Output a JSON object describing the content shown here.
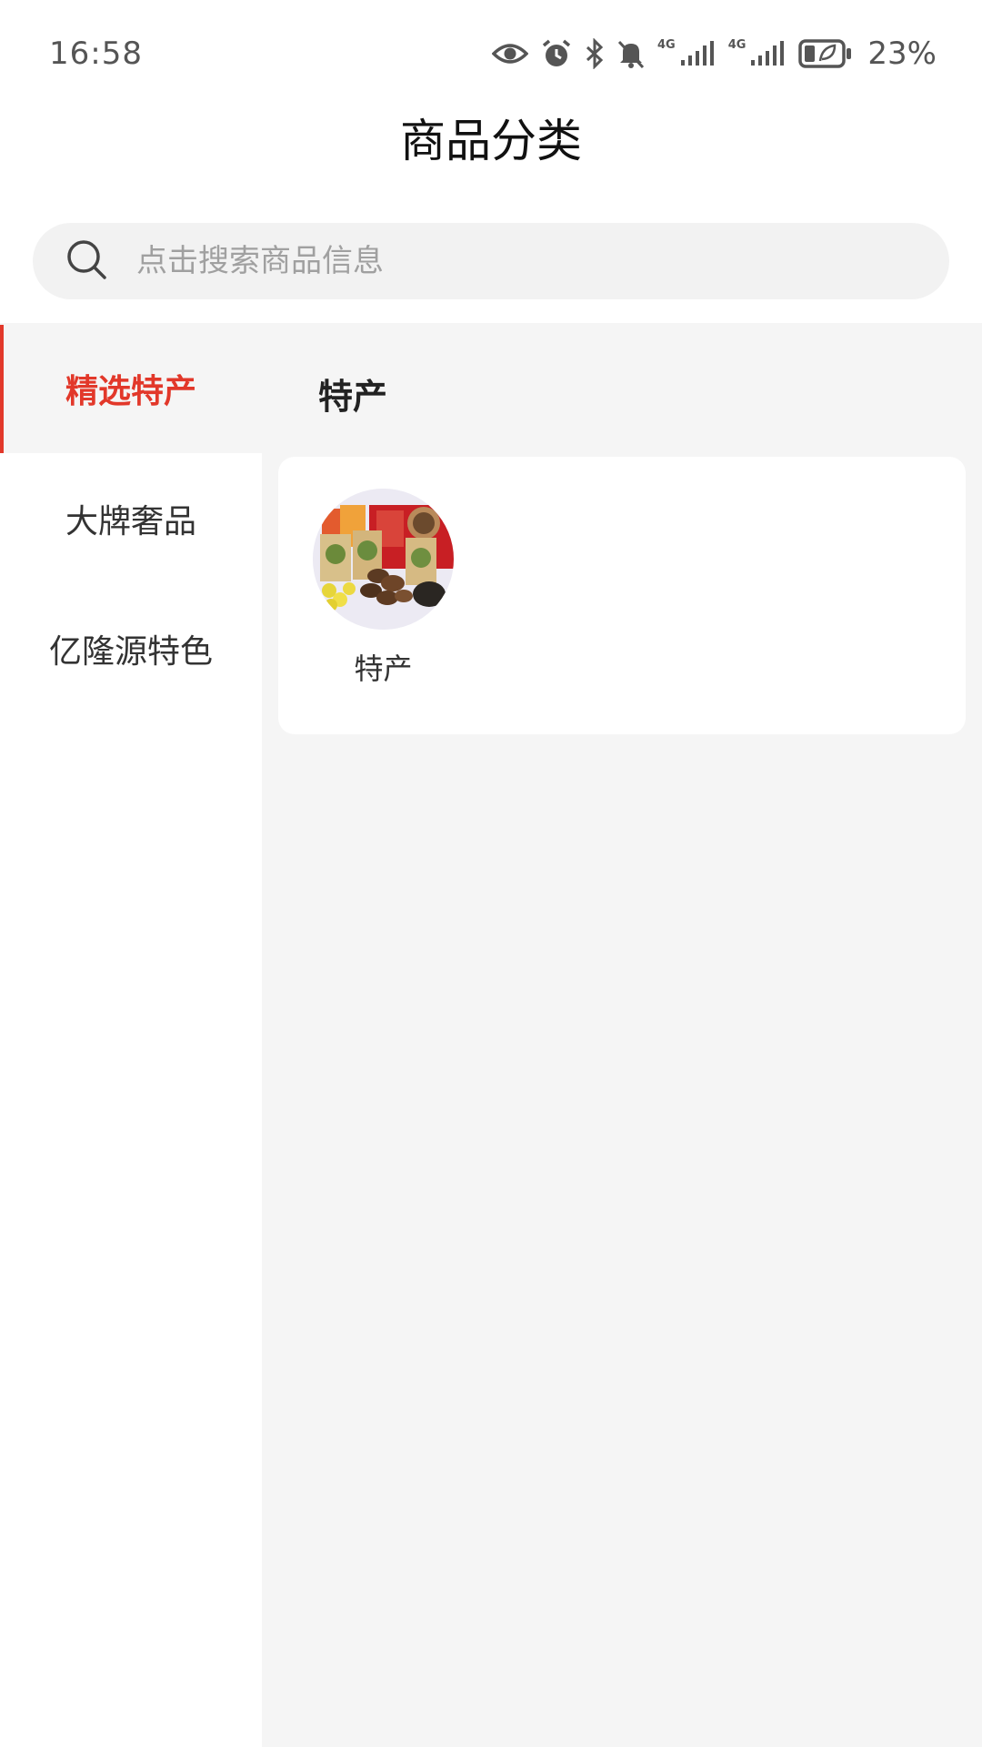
{
  "status_bar": {
    "time": "16:58",
    "battery": "23%",
    "net1": "4G",
    "net2": "4G",
    "icons": [
      "eye-icon",
      "alarm-icon",
      "bluetooth-icon",
      "mute-icon",
      "signal-icon",
      "signal-icon",
      "battery-icon"
    ]
  },
  "header": {
    "title": "商品分类"
  },
  "search": {
    "placeholder": "点击搜索商品信息"
  },
  "sidebar": {
    "items": [
      {
        "label": "精选特产",
        "active": true
      },
      {
        "label": "大牌奢品",
        "active": false
      },
      {
        "label": "亿隆源特色",
        "active": false
      }
    ]
  },
  "main": {
    "section_title": "特产",
    "categories": [
      {
        "label": "特产",
        "image": "specialty-products-image"
      }
    ]
  },
  "colors": {
    "accent": "#e2382a",
    "background": "#f5f5f5"
  }
}
